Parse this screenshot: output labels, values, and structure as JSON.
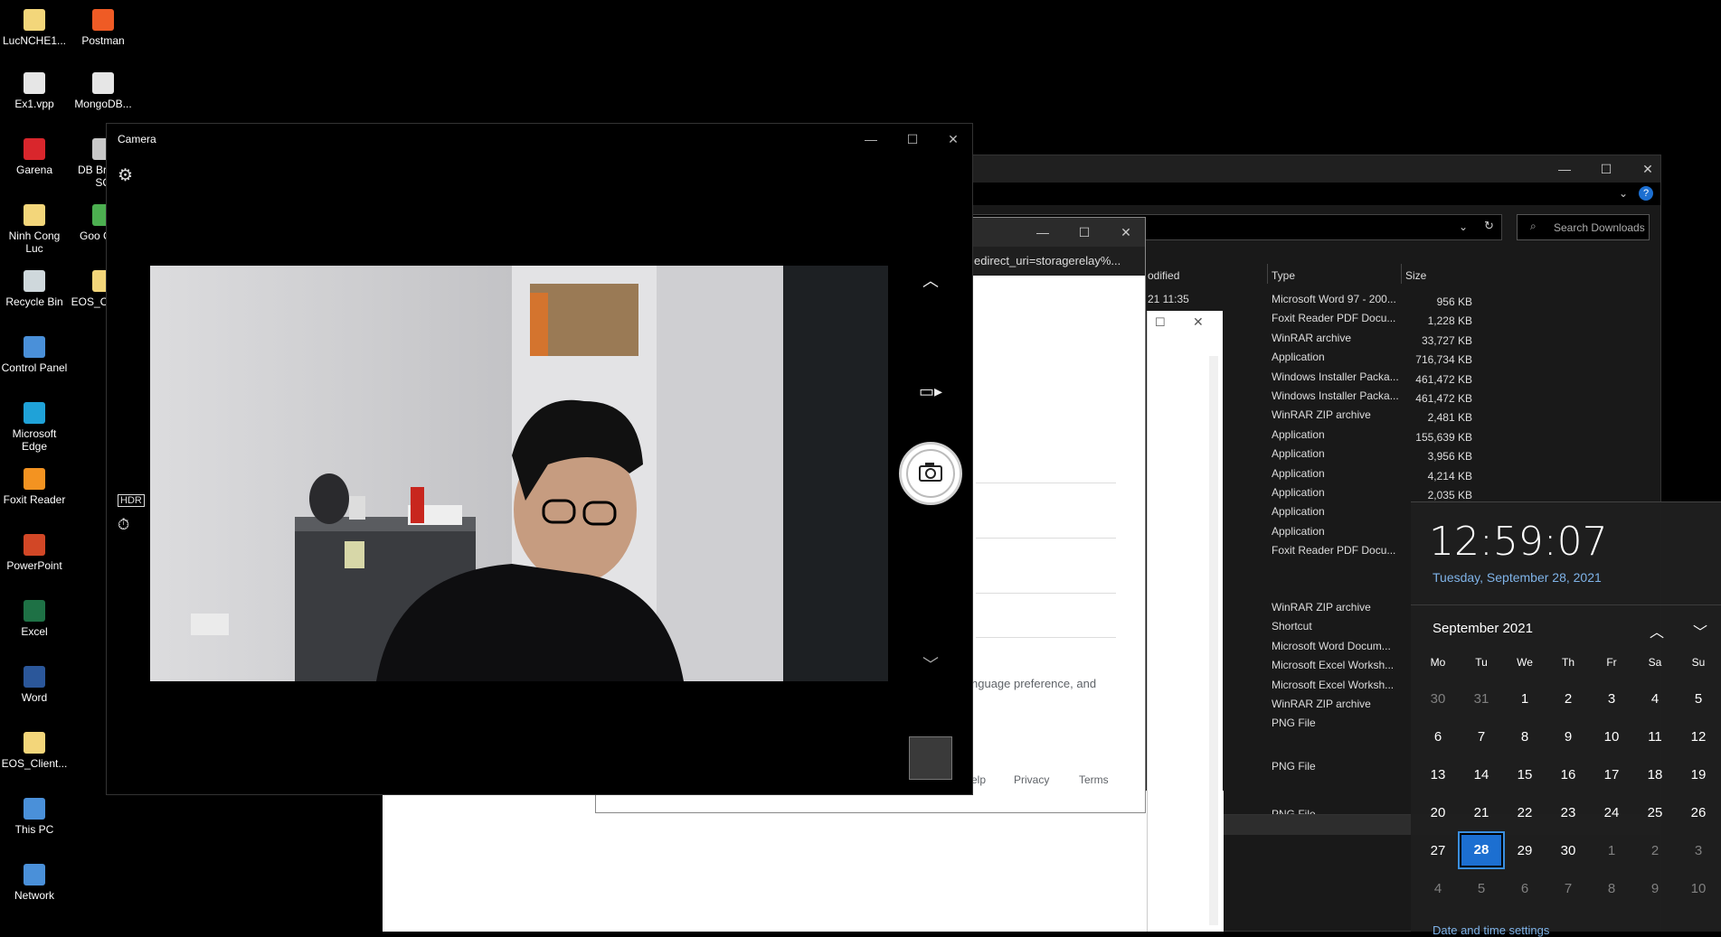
{
  "desktop": {
    "icons": [
      {
        "label": "LucNCHE1...",
        "color": "#f3d67a"
      },
      {
        "label": "Postman",
        "color": "#ef5b25"
      },
      {
        "label": "Ex1.vpp",
        "color": "#e6e6e6"
      },
      {
        "label": "MongoDB...",
        "color": "#e6e6e6"
      },
      {
        "label": "Garena",
        "color": "#d9262c"
      },
      {
        "label": "DB Bro for SQ",
        "color": "#c8c8c8"
      },
      {
        "label": "Ninh Cong Luc",
        "color": "#f3d67a"
      },
      {
        "label": "Goo Chro",
        "color": "#4caf50"
      },
      {
        "label": "Recycle Bin",
        "color": "#cfd8dc"
      },
      {
        "label": "EOS_Cl - tu_",
        "color": "#f3d67a"
      },
      {
        "label": "Control Panel",
        "color": "#4a90d9"
      },
      {
        "label": "Microsoft Edge",
        "color": "#1fa2d8"
      },
      {
        "label": "Foxit Reader",
        "color": "#f39321"
      },
      {
        "label": "PowerPoint",
        "color": "#d24726"
      },
      {
        "label": "Excel",
        "color": "#1e7145"
      },
      {
        "label": "Word",
        "color": "#2b579a"
      },
      {
        "label": "EOS_Client...",
        "color": "#f3d67a"
      },
      {
        "label": "This PC",
        "color": "#4a90d9"
      },
      {
        "label": "Network",
        "color": "#4a90d9"
      }
    ]
  },
  "camera": {
    "title": "Camera",
    "buttons": {
      "minimize": "—",
      "maximize": "☐",
      "close": "✕"
    }
  },
  "browser": {
    "url_fragment": "edirect_uri=storagerelay%...",
    "body_fragment": "nguage preference, and",
    "footer": {
      "help": "elp",
      "privacy": "Privacy",
      "terms": "Terms"
    }
  },
  "explorer": {
    "search_placeholder": "Search Downloads",
    "columns": {
      "modified": "odified",
      "type": "Type",
      "size": "Size"
    },
    "first_modified": "21 11:35",
    "files": [
      {
        "type": "Microsoft Word 97 - 200...",
        "size": "956 KB"
      },
      {
        "type": "Foxit Reader PDF Docu...",
        "size": "1,228 KB"
      },
      {
        "type": "WinRAR archive",
        "size": "33,727 KB"
      },
      {
        "type": "Application",
        "size": "716,734 KB"
      },
      {
        "type": "Windows Installer Packa...",
        "size": "461,472 KB"
      },
      {
        "type": "Windows Installer Packa...",
        "size": "461,472 KB"
      },
      {
        "type": "WinRAR ZIP archive",
        "size": "2,481 KB"
      },
      {
        "type": "Application",
        "size": "155,639 KB"
      },
      {
        "type": "Application",
        "size": "3,956 KB"
      },
      {
        "type": "Application",
        "size": "4,214 KB"
      },
      {
        "type": "Application",
        "size": "2,035 KB"
      },
      {
        "type": "Application",
        "size": ""
      },
      {
        "type": "Application",
        "size": ""
      },
      {
        "type": "Foxit Reader PDF Docu...",
        "size": ""
      }
    ],
    "files2": [
      {
        "type": "WinRAR ZIP archive"
      },
      {
        "type": "Shortcut"
      },
      {
        "type": "Microsoft Word Docum..."
      },
      {
        "type": "Microsoft Excel Worksh..."
      },
      {
        "type": "Microsoft Excel Worksh..."
      },
      {
        "type": "WinRAR ZIP archive"
      },
      {
        "type": "PNG File"
      }
    ],
    "files3": [
      {
        "type": "PNG File"
      },
      {
        "type": "PNG File"
      }
    ]
  },
  "clock": {
    "time": "12:59:07",
    "date": "Tuesday, September 28, 2021",
    "month": "September 2021",
    "weekdays": [
      "Mo",
      "Tu",
      "We",
      "Th",
      "Fr",
      "Sa",
      "Su"
    ],
    "weeks": [
      [
        "30",
        "31",
        "1",
        "2",
        "3",
        "4",
        "5"
      ],
      [
        "6",
        "7",
        "8",
        "9",
        "10",
        "11",
        "12"
      ],
      [
        "13",
        "14",
        "15",
        "16",
        "17",
        "18",
        "19"
      ],
      [
        "20",
        "21",
        "22",
        "23",
        "24",
        "25",
        "26"
      ],
      [
        "27",
        "28",
        "29",
        "30",
        "1",
        "2",
        "3"
      ],
      [
        "4",
        "5",
        "6",
        "7",
        "8",
        "9",
        "10"
      ]
    ],
    "today": "28",
    "settings_link": "Date and time settings",
    "accent": "#1c6fd1"
  }
}
